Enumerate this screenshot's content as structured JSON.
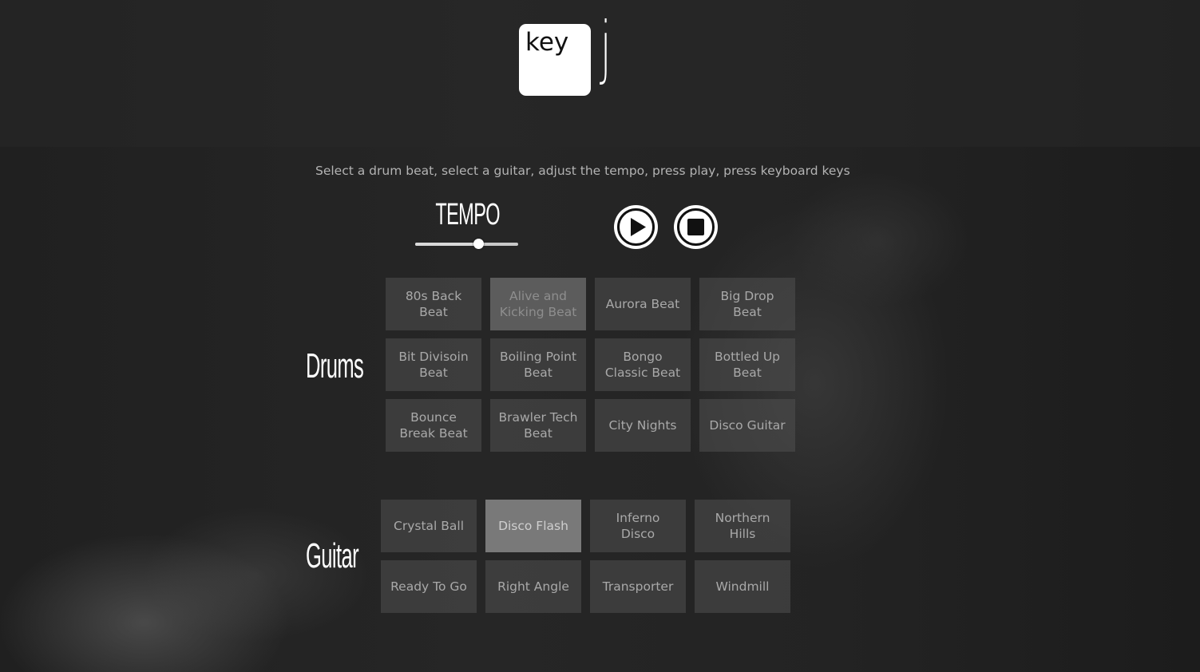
{
  "logo": {
    "key_text": "key",
    "j_text": "j"
  },
  "instructions": "Select a drum beat, select a guitar, adjust the tempo, press play, press keyboard keys",
  "tempo": {
    "label": "TEMPO",
    "value_fraction": 0.61
  },
  "controls": {
    "play_icon": "play-icon",
    "stop_icon": "stop-icon"
  },
  "drums": {
    "label": "Drums",
    "selected_index": 1,
    "items": [
      {
        "label": "80s Back Beat"
      },
      {
        "label": "Alive and Kicking Beat"
      },
      {
        "label": "Aurora Beat"
      },
      {
        "label": "Big Drop Beat"
      },
      {
        "label": "Bit Divisoin Beat"
      },
      {
        "label": "Boiling Point Beat"
      },
      {
        "label": "Bongo Classic Beat"
      },
      {
        "label": "Bottled Up Beat"
      },
      {
        "label": "Bounce Break Beat"
      },
      {
        "label": "Brawler Tech Beat"
      },
      {
        "label": "City Nights"
      },
      {
        "label": "Disco Guitar"
      }
    ]
  },
  "guitar": {
    "label": "Guitar",
    "selected_index": 1,
    "items": [
      {
        "label": "Crystal Ball"
      },
      {
        "label": "Disco Flash"
      },
      {
        "label": "Inferno Disco"
      },
      {
        "label": "Northern Hills"
      },
      {
        "label": "Ready To Go"
      },
      {
        "label": "Right Angle"
      },
      {
        "label": "Transporter"
      },
      {
        "label": "Windmill"
      }
    ]
  },
  "colors": {
    "background": "#1e1e1e",
    "tile": "#505050",
    "tile_text": "#a9a9a9",
    "accent": "#ffffff"
  }
}
